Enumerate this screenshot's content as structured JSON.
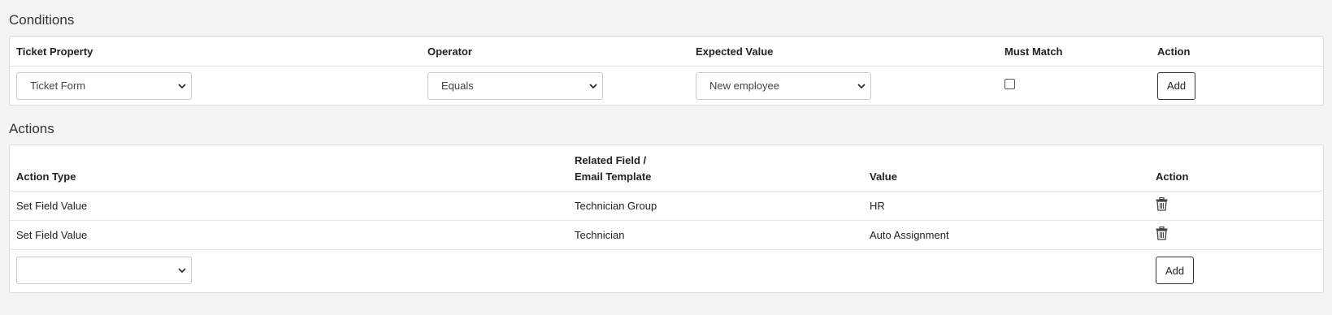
{
  "conditions": {
    "title": "Conditions",
    "headers": {
      "ticket_property": "Ticket Property",
      "operator": "Operator",
      "expected_value": "Expected Value",
      "must_match": "Must Match",
      "action": "Action"
    },
    "row": {
      "ticket_property_value": "Ticket Form",
      "operator_value": "Equals",
      "expected_value": "New employee",
      "must_match_checked": false,
      "add_label": "Add"
    }
  },
  "actions": {
    "title": "Actions",
    "headers": {
      "action_type": "Action Type",
      "related_field_line1": "Related Field /",
      "related_field_line2": "Email Template",
      "value": "Value",
      "action": "Action"
    },
    "rows": [
      {
        "action_type": "Set Field Value",
        "related_field": "Technician Group",
        "value": "HR",
        "icon": "trash-icon"
      },
      {
        "action_type": "Set Field Value",
        "related_field": "Technician",
        "value": "Auto Assignment",
        "icon": "trash-icon"
      }
    ],
    "new_row": {
      "action_type_value": "",
      "add_label": "Add"
    }
  }
}
